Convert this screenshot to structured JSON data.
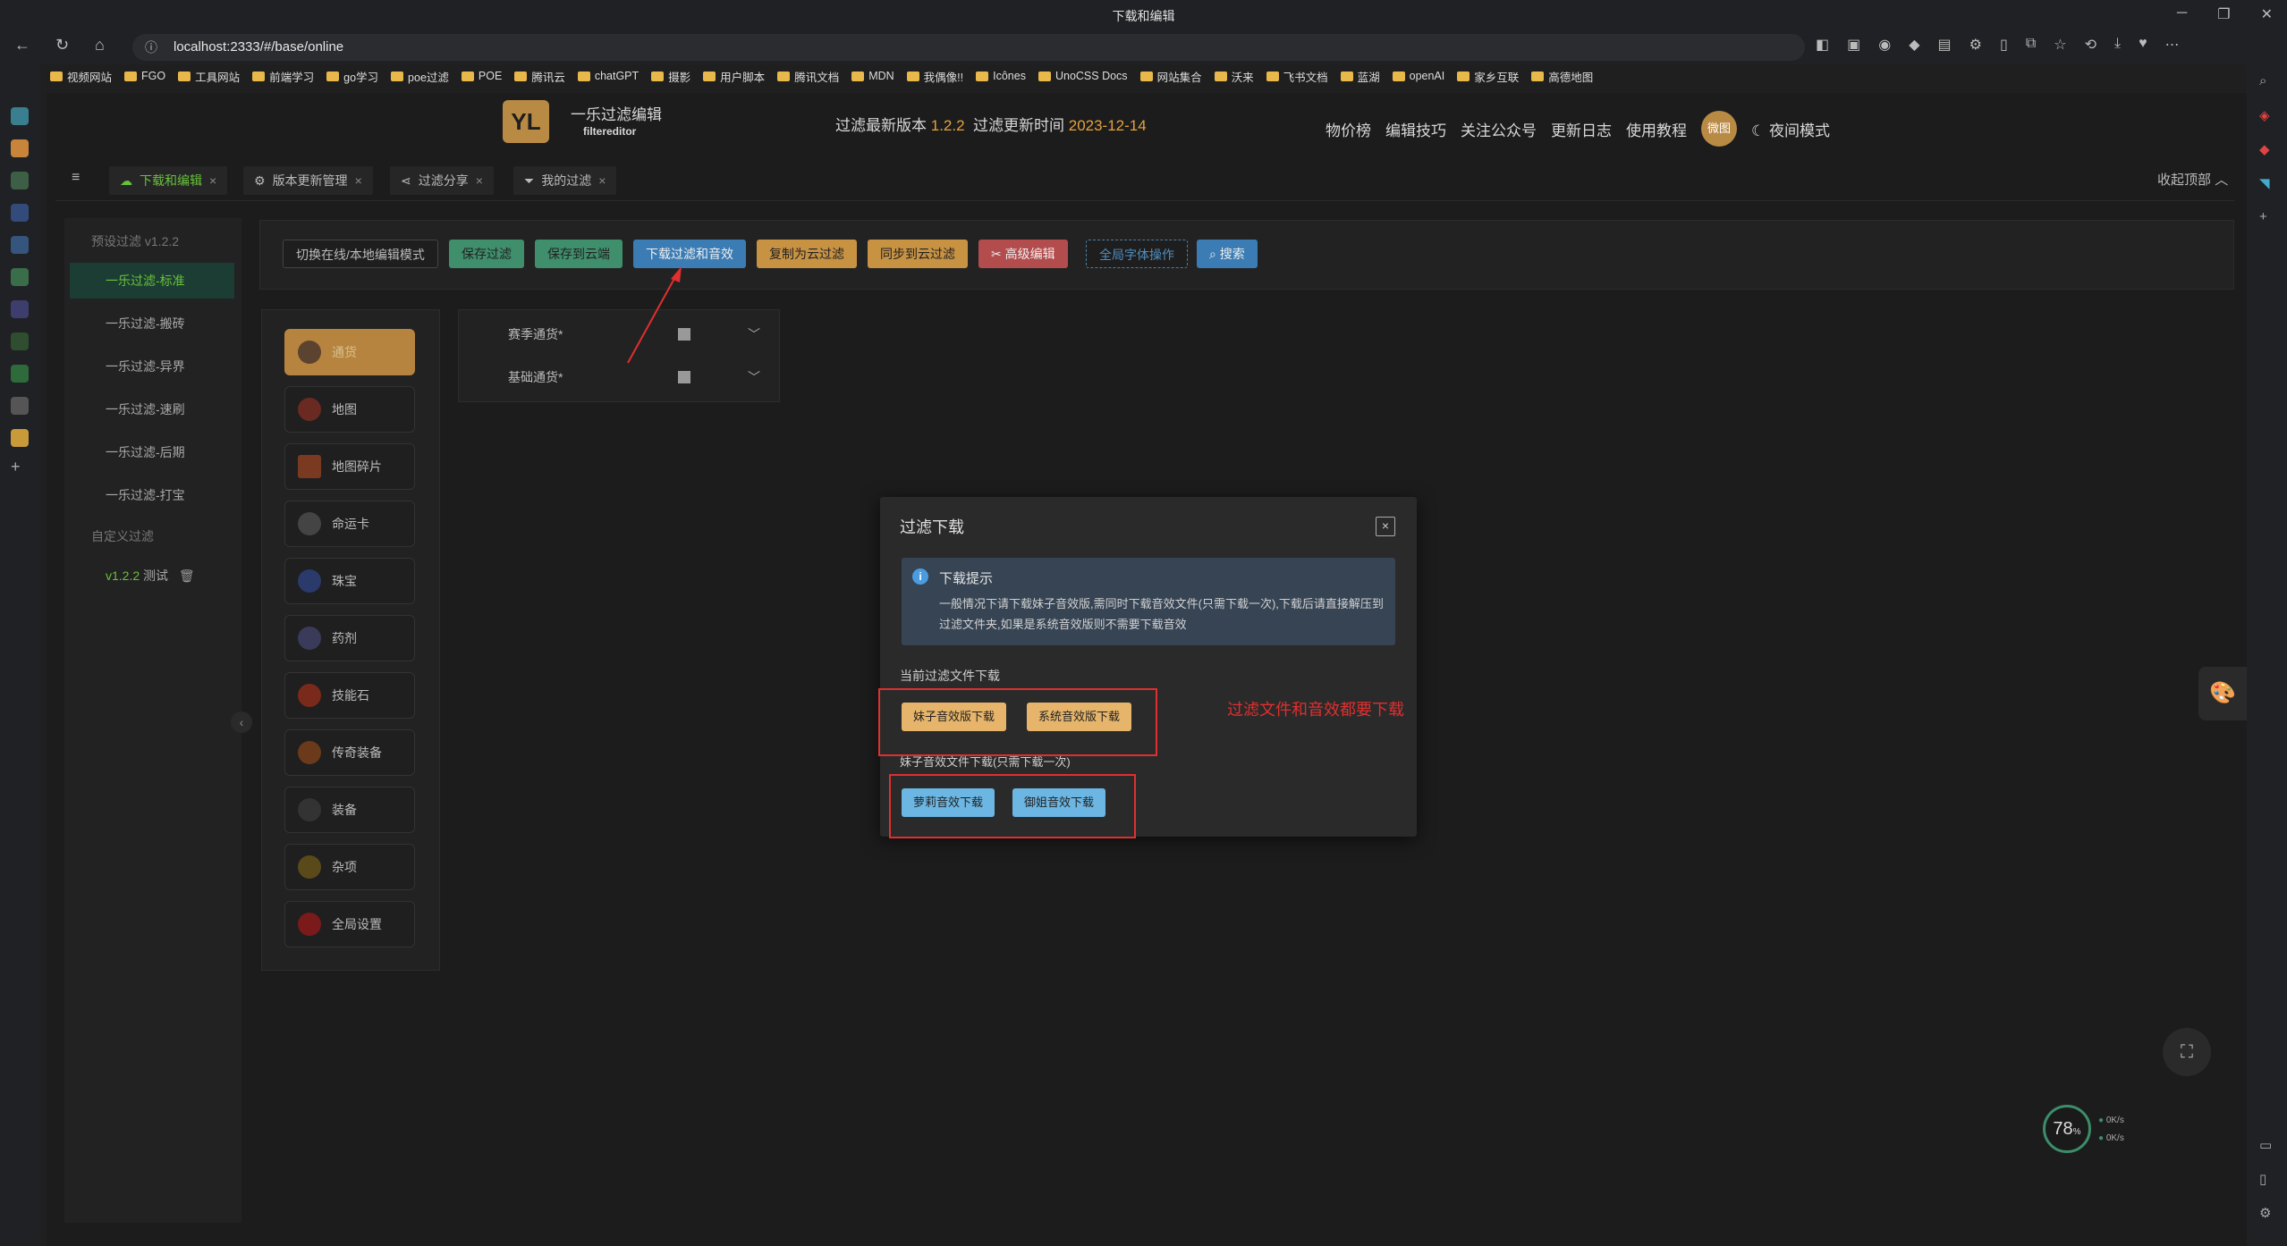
{
  "window": {
    "title": "下载和编辑"
  },
  "browser": {
    "url": "localhost:2333/#/base/online",
    "bookmarks": [
      "视频网站",
      "FGO",
      "工具网站",
      "前端学习",
      "go学习",
      "poe过滤",
      "POE",
      "腾讯云",
      "chatGPT",
      "摄影",
      "用户脚本",
      "腾讯文档",
      "MDN",
      "我偶像!!",
      "Icônes",
      "UnoCSS Docs",
      "网站集合",
      "沃来",
      "飞书文档",
      "蓝湖",
      "openAI",
      "家乡互联",
      "高德地图"
    ]
  },
  "header": {
    "logo_text": "YL",
    "brand": "一乐过滤编辑",
    "brand_sub": "filtereditor",
    "version_label": "过滤最新版本",
    "version": "1.2.2",
    "update_label": "过滤更新时间",
    "update_date": "2023-12-14",
    "nav": [
      "物价榜",
      "编辑技巧",
      "关注公众号",
      "更新日志",
      "使用教程"
    ],
    "avatar_text": "微图",
    "night_mode": "夜间模式"
  },
  "tabs": [
    {
      "label": "下载和编辑",
      "icon": "cloud-icon",
      "active": true
    },
    {
      "label": "版本更新管理",
      "icon": "gear-icon",
      "active": false
    },
    {
      "label": "过滤分享",
      "icon": "share-icon",
      "active": false
    },
    {
      "label": "我的过滤",
      "icon": "filter-icon",
      "active": false
    }
  ],
  "collapse_top": "收起顶部",
  "sidebar": {
    "preset_heading": "预设过滤 v1.2.2",
    "items": [
      "一乐过滤-标准",
      "一乐过滤-搬砖",
      "一乐过滤-异界",
      "一乐过滤-速刷",
      "一乐过滤-后期",
      "一乐过滤-打宝"
    ],
    "custom_heading": "自定义过滤",
    "custom_version": "v1.2.2",
    "custom_name": "测试"
  },
  "toolbar": {
    "switch_mode": "切换在线/本地编辑模式",
    "save": "保存过滤",
    "save_cloud": "保存到云端",
    "download": "下载过滤和音效",
    "copy_cloud": "复制为云过滤",
    "sync_cloud": "同步到云过滤",
    "advanced": "高级编辑",
    "font_ops": "全局字体操作",
    "search": "搜索"
  },
  "categories": [
    "通货",
    "地图",
    "地图碎片",
    "命运卡",
    "珠宝",
    "药剂",
    "技能石",
    "传奇装备",
    "装备",
    "杂项",
    "全局设置"
  ],
  "subitems": [
    "赛季通货*",
    "基础通货*"
  ],
  "dialog": {
    "title": "过滤下载",
    "tip_title": "下载提示",
    "tip_text": "一般情况下请下载妹子音效版,需同时下载音效文件(只需下载一次),下载后请直接解压到过滤文件夹,如果是系统音效版则不需要下载音效",
    "current_label": "当前过滤文件下载",
    "btn_girl": "妹子音效版下载",
    "btn_system": "系统音效版下载",
    "sound_label": "妹子音效文件下载(只需下载一次)",
    "btn_loli": "萝莉音效下载",
    "btn_sister": "御姐音效下载"
  },
  "annotation": "过滤文件和音效都要下载",
  "meter": {
    "value": "78",
    "unit": "%",
    "up": "0K/s",
    "down": "0K/s"
  },
  "colors": {
    "accent_green": "#67c23a",
    "brand_orange": "#b98a44",
    "annotation_red": "#e02f2f"
  }
}
